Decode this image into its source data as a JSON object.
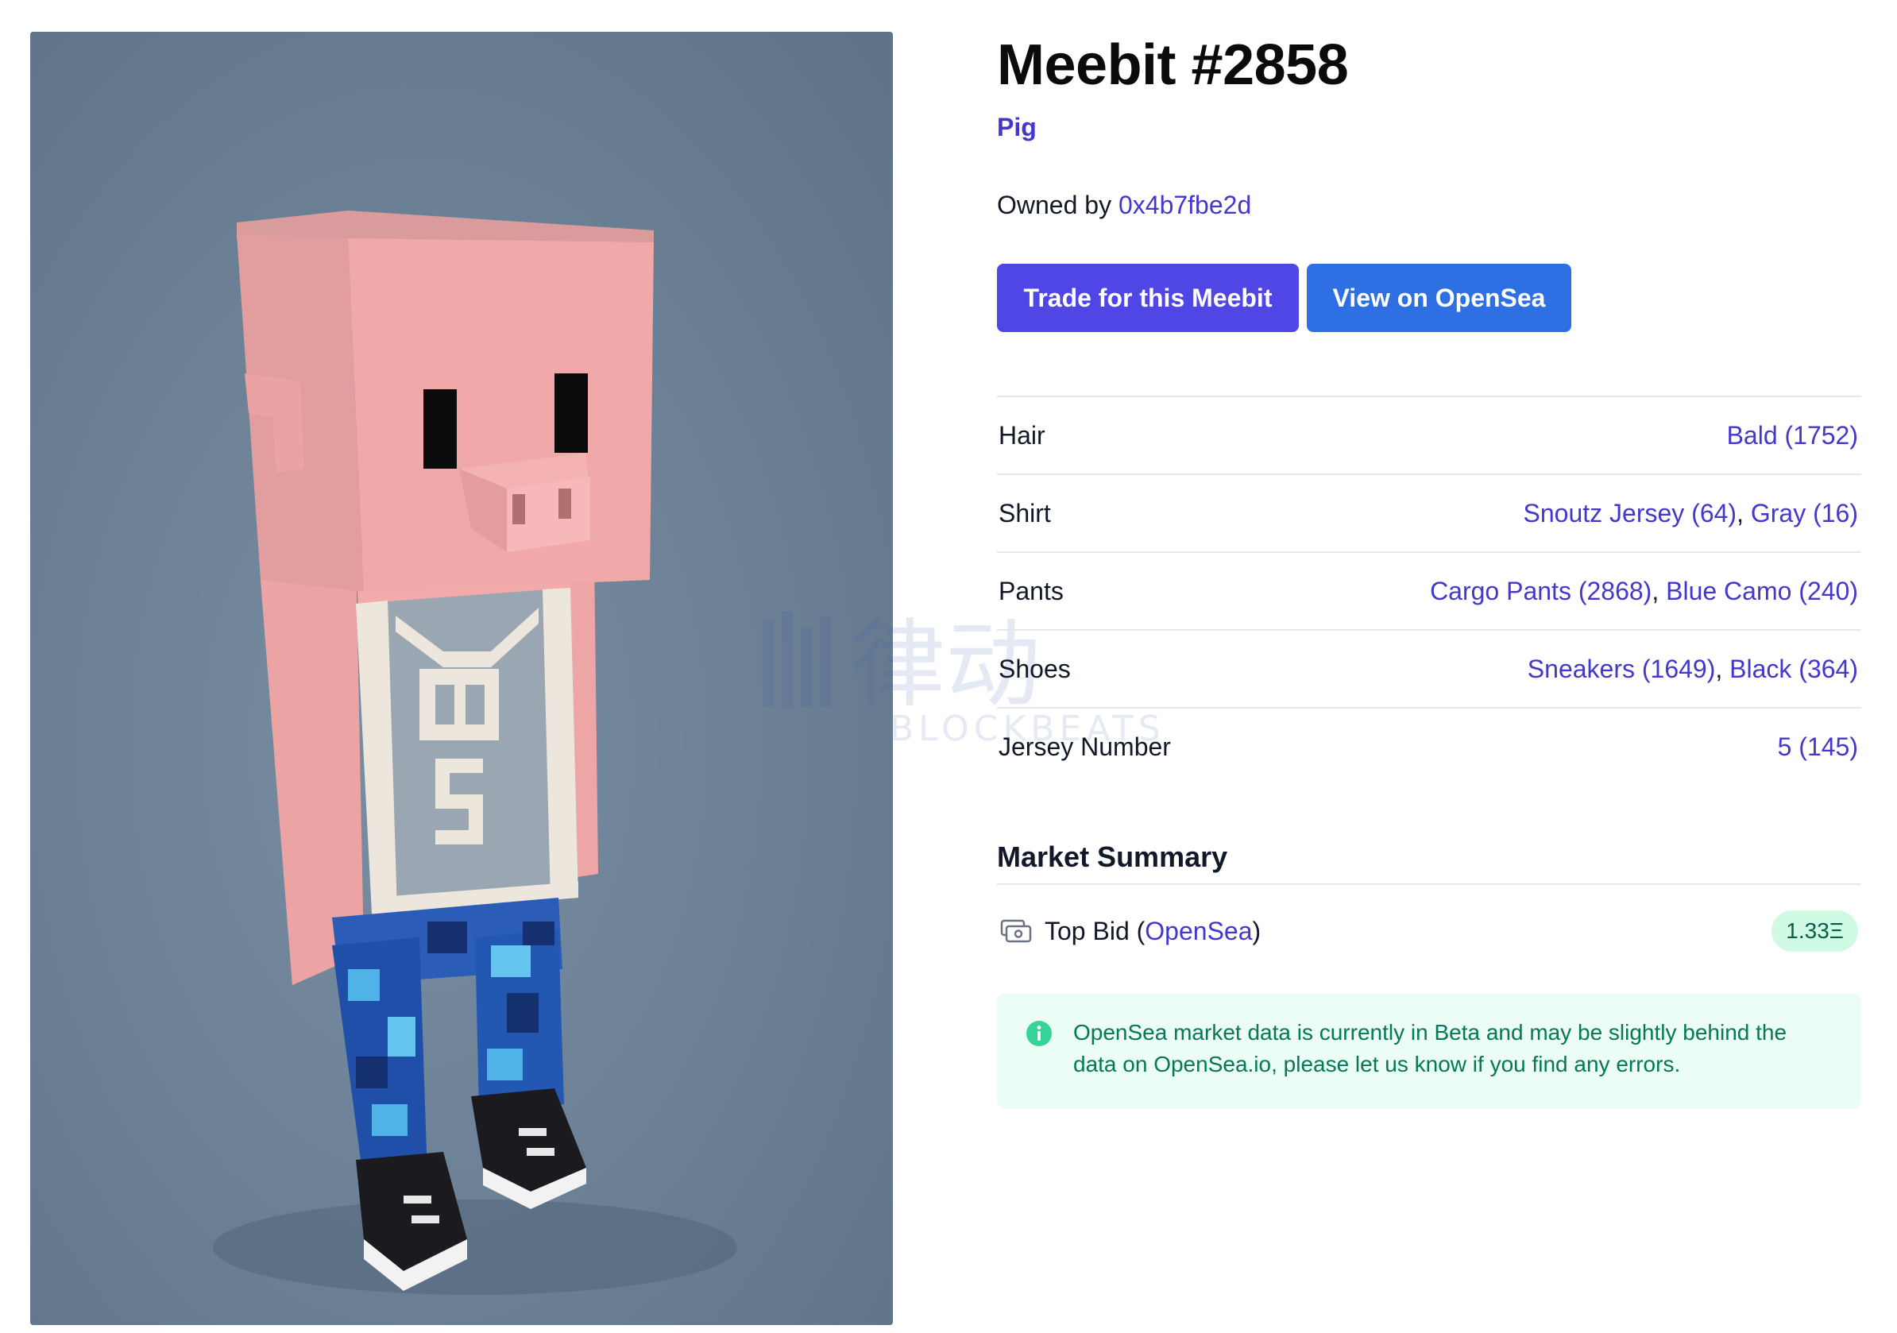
{
  "meebit": {
    "title": "Meebit #2858",
    "type": "Pig"
  },
  "owner": {
    "prefix": "Owned by ",
    "address": "0x4b7fbe2d"
  },
  "actions": {
    "trade_label": "Trade for this Meebit",
    "opensea_label": "View on OpenSea"
  },
  "traits": [
    {
      "name": "Hair",
      "values": [
        "Bald (1752)"
      ]
    },
    {
      "name": "Shirt",
      "values": [
        "Snoutz Jersey (64)",
        "Gray (16)"
      ]
    },
    {
      "name": "Pants",
      "values": [
        "Cargo Pants (2868)",
        "Blue Camo (240)"
      ]
    },
    {
      "name": "Shoes",
      "values": [
        "Sneakers (1649)",
        "Black (364)"
      ]
    },
    {
      "name": "Jersey Number",
      "values": [
        "5 (145)"
      ]
    }
  ],
  "market": {
    "heading": "Market Summary",
    "top_bid_label": "Top Bid (",
    "top_bid_source": "OpenSea",
    "top_bid_suffix": ")",
    "top_bid_value": "1.33Ξ",
    "notice": "OpenSea market data is currently in Beta and may be slightly behind the data on OpenSea.io, please let us know if you find any errors."
  },
  "watermark": {
    "cn": "律动",
    "en": "BLOCKBEATS"
  },
  "colors": {
    "accent": "#4338ca",
    "trade_button": "#5046e5",
    "opensea_button": "#2f6fe4",
    "badge_bg": "#d1fae5",
    "notice_bg": "#ecfdf5",
    "image_bg": "#6a7f94",
    "pig_pink": "#f0a8a8"
  },
  "icons": {
    "bid": "cash-icon",
    "notice": "info-circle-icon"
  }
}
